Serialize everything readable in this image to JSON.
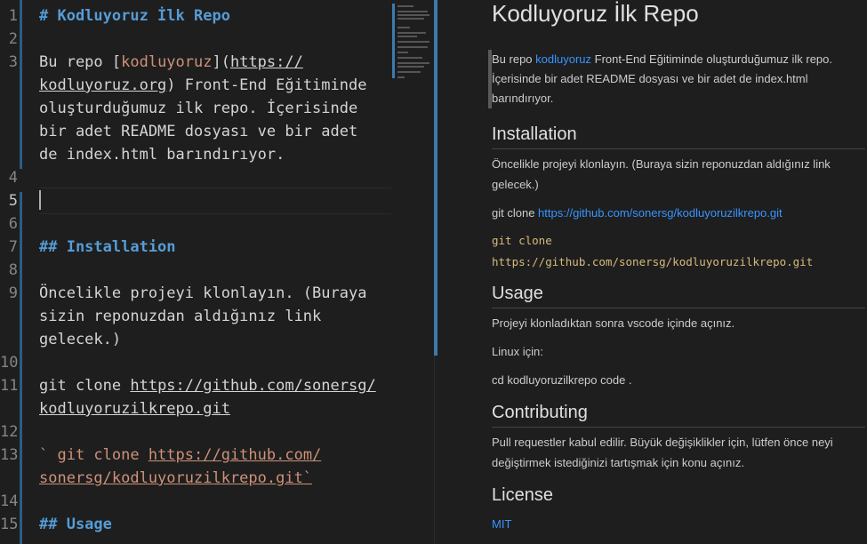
{
  "editor": {
    "line_numbers": [
      "1",
      "2",
      "3",
      "4",
      "5",
      "6",
      "7",
      "8",
      "9",
      "10",
      "11",
      "12",
      "13",
      "14",
      "15"
    ],
    "lines": {
      "l1": "# Kodluyoruz İlk Repo",
      "l3a_pre": "Bu repo [",
      "l3a_link": "kodluyoruz",
      "l3a_mid": "](",
      "l3a_url": "https://",
      "l3b_url": "kodluyoruz.org",
      "l3b_rest": ") Front-End Eğitiminde",
      "l3c": "oluşturduğumuz ilk repo. İçerisinde",
      "l3d": "bir adet README dosyası ve bir adet",
      "l3e": "de index.html barındırıyor.",
      "l7": "## Installation",
      "l9a": "Öncelikle projeyi klonlayın. (Buraya",
      "l9b": "sizin reponuzdan aldığınız link",
      "l9c": "gelecek.)",
      "l11a_pre": "git clone ",
      "l11a_url": "https://github.com/sonersg/",
      "l11b_url": "kodluyoruzilkrepo.git",
      "l13a_pre": "` git clone ",
      "l13a_url": "https://github.com/",
      "l13b": "sonersg/kodluyoruzilkrepo.git`",
      "l15": "## Usage"
    }
  },
  "preview": {
    "title": "Kodluyoruz İlk Repo",
    "intro_pre": "Bu repo ",
    "intro_link": "kodluyoruz",
    "intro_post": " Front-End Eğitiminde oluşturduğumuz ilk repo. İçerisinde bir adet README dosyası ve bir adet de index.html barındırıyor.",
    "installation_heading": "Installation",
    "installation_text": "Öncelikle projeyi klonlayın. (Buraya sizin reponuzdan aldığınız link gelecek.)",
    "clone_pre": "git clone ",
    "clone_url": "https://github.com/sonersg/kodluyoruzilkrepo.git",
    "code_line1": "git clone",
    "code_line2": "https://github.com/sonersg/kodluyoruzilkrepo.git",
    "usage_heading": "Usage",
    "usage_text": "Projeyi klonladıktan sonra vscode içinde açınız.",
    "linux_text": "Linux için:",
    "linux_cmd": "cd kodluyoruzilkrepo code .",
    "contributing_heading": "Contributing",
    "contributing_text": "Pull requestler kabul edilir. Büyük değişiklikler için, lütfen önce neyi değiştirmek istediğinizi tartışmak için konu açınız.",
    "license_heading": "License",
    "license_link": "MIT"
  },
  "colors": {
    "background": "#1e1e1e",
    "heading": "#569cd6",
    "string": "#ce9178",
    "link": "#3794ff",
    "code": "#d7ba7d"
  }
}
